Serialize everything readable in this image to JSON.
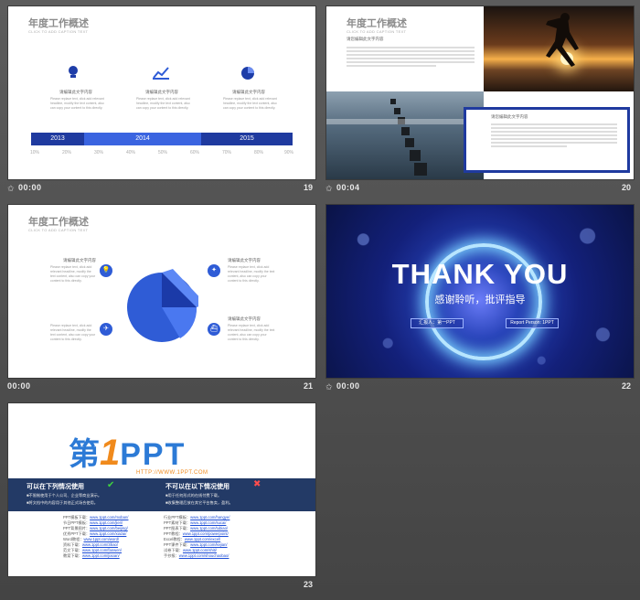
{
  "slides": [
    {
      "number": "19",
      "time": "00:00",
      "title": "年度工作概述",
      "subtitle": "CLICK TO ADD CAPTION TEXT",
      "items": [
        "请编辑此文字内容",
        "请编辑此文字内容",
        "请编辑此文字内容"
      ],
      "item_text": "Please replace text, click add relevant headline, modify the text content, also can copy your content to this directly.",
      "timeline": [
        "2013",
        "2014",
        "2015"
      ],
      "percents": [
        "10%",
        "20%",
        "30%",
        "40%",
        "50%",
        "60%",
        "70%",
        "80%",
        "90%"
      ],
      "icons": [
        "lightbulb-icon",
        "chart-icon",
        "pie-icon"
      ]
    },
    {
      "number": "20",
      "time": "00:04",
      "title": "年度工作概述",
      "subtitle": "CLICK TO ADD CAPTION TEXT",
      "heading1": "请您编辑此文字内容",
      "heading2": "请您编辑此文字内容"
    },
    {
      "number": "21",
      "time": "00:00",
      "title": "年度工作概述",
      "subtitle": "CLICK TO ADD CAPTION TEXT",
      "items": [
        "请编辑此文字内容",
        "请编辑此文字内容",
        "请编辑此文字内容",
        "请编辑此文字内容"
      ],
      "item_text": "Please replace text, click add relevant headline, modify the text content, also can copy your content to this directly."
    },
    {
      "number": "22",
      "time": "00:00",
      "thank": "THANK YOU",
      "thanks_cn": "感谢聆听，批评指导",
      "reporter": "汇报人：第一PPT",
      "person": "Report Person: 1PPT"
    },
    {
      "number": "23",
      "logo_first": "第",
      "logo_one": "1",
      "logo_ppt": "PPT",
      "logo_url": "HTTP://WWW.1PPT.COM",
      "can_title": "可以在下列情况使用",
      "can_lines": [
        "■不限制使用于个人公司、企业等商业演示。",
        "■将文档中的内容用于其他正式场合使用。"
      ],
      "cannot_title": "不可以在以下情况使用",
      "cannot_lines": [
        "■用于任何形式的在线付费下载。",
        "■收集整理后放在其它平台售卖，盈利。"
      ],
      "links_left": [
        [
          "PPT模板下载：",
          "www.1ppt.com/moban/"
        ],
        [
          "节日PPT模板：",
          "www.1ppt.com/jieri/"
        ],
        [
          "PPT背景图片：",
          "www.1ppt.com/beijing/"
        ],
        [
          "优秀PPT下载：",
          "www.1ppt.com/xiazai/"
        ],
        [
          "Word教程：",
          "www.1ppt.com/word/"
        ],
        [
          "资料下载：",
          "www.1ppt.com/ziliao/"
        ],
        [
          "范文下载：",
          "www.1ppt.com/fanwen/"
        ],
        [
          "教案下载：",
          "www.1ppt.com/jiaoan/"
        ]
      ],
      "links_right": [
        [
          "行业PPT模板：",
          "www.1ppt.com/hangye/"
        ],
        [
          "PPT素材下载：",
          "www.1ppt.com/sucai/"
        ],
        [
          "PPT图表下载：",
          "www.1ppt.com/tubiao/"
        ],
        [
          "PPT教程：",
          "www.1ppt.com/powerpoint/"
        ],
        [
          "Excel教程：",
          "www.1ppt.com/excel/"
        ],
        [
          "PPT课件下载：",
          "www.1ppt.com/kejian/"
        ],
        [
          "试卷下载：",
          "www.1ppt.com/shiti/"
        ],
        [
          "手抄报：",
          "www.1ppt.com/shouchaobao/"
        ]
      ]
    }
  ]
}
